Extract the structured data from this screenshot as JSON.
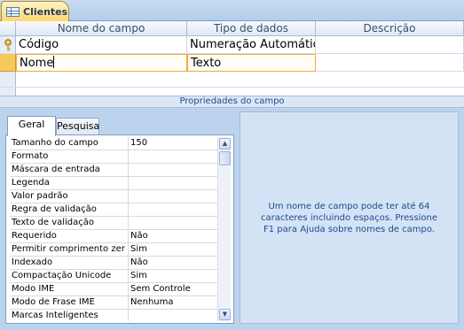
{
  "document_tab": {
    "label": "Clientes",
    "icon": "table-icon"
  },
  "grid": {
    "columns": [
      "Nome do campo",
      "Tipo de dados",
      "Descrição"
    ],
    "rows": [
      {
        "name": "Código",
        "type": "Numeração Automátic",
        "description": "",
        "primary_key": true
      },
      {
        "name": "Nome",
        "type": "Texto",
        "description": "",
        "primary_key": false
      }
    ]
  },
  "properties_title": "Propriedades do campo",
  "property_tabs": [
    "Geral",
    "Pesquisa"
  ],
  "properties": [
    {
      "name": "Tamanho do campo",
      "value": "150"
    },
    {
      "name": "Formato",
      "value": ""
    },
    {
      "name": "Máscara de entrada",
      "value": ""
    },
    {
      "name": "Legenda",
      "value": ""
    },
    {
      "name": "Valor padrão",
      "value": ""
    },
    {
      "name": "Regra de validação",
      "value": ""
    },
    {
      "name": "Texto de validação",
      "value": ""
    },
    {
      "name": "Requerido",
      "value": "Não"
    },
    {
      "name": "Permitir comprimento zer",
      "value": "Sim"
    },
    {
      "name": "Indexado",
      "value": "Não"
    },
    {
      "name": "Compactação Unicode",
      "value": "Sim"
    },
    {
      "name": "Modo IME",
      "value": "Sem Controle"
    },
    {
      "name": "Modo de Frase IME",
      "value": "Nenhuma"
    },
    {
      "name": "Marcas Inteligentes",
      "value": ""
    }
  ],
  "help_text": "Um nome de campo pode ter até 64 caracteres incluindo espaços. Pressione F1 para Ajuda sobre nomes de campo.",
  "colors": {
    "accent": "#f5c95c",
    "help_text": "#1e4a8c",
    "background": "#bcd3ee"
  }
}
